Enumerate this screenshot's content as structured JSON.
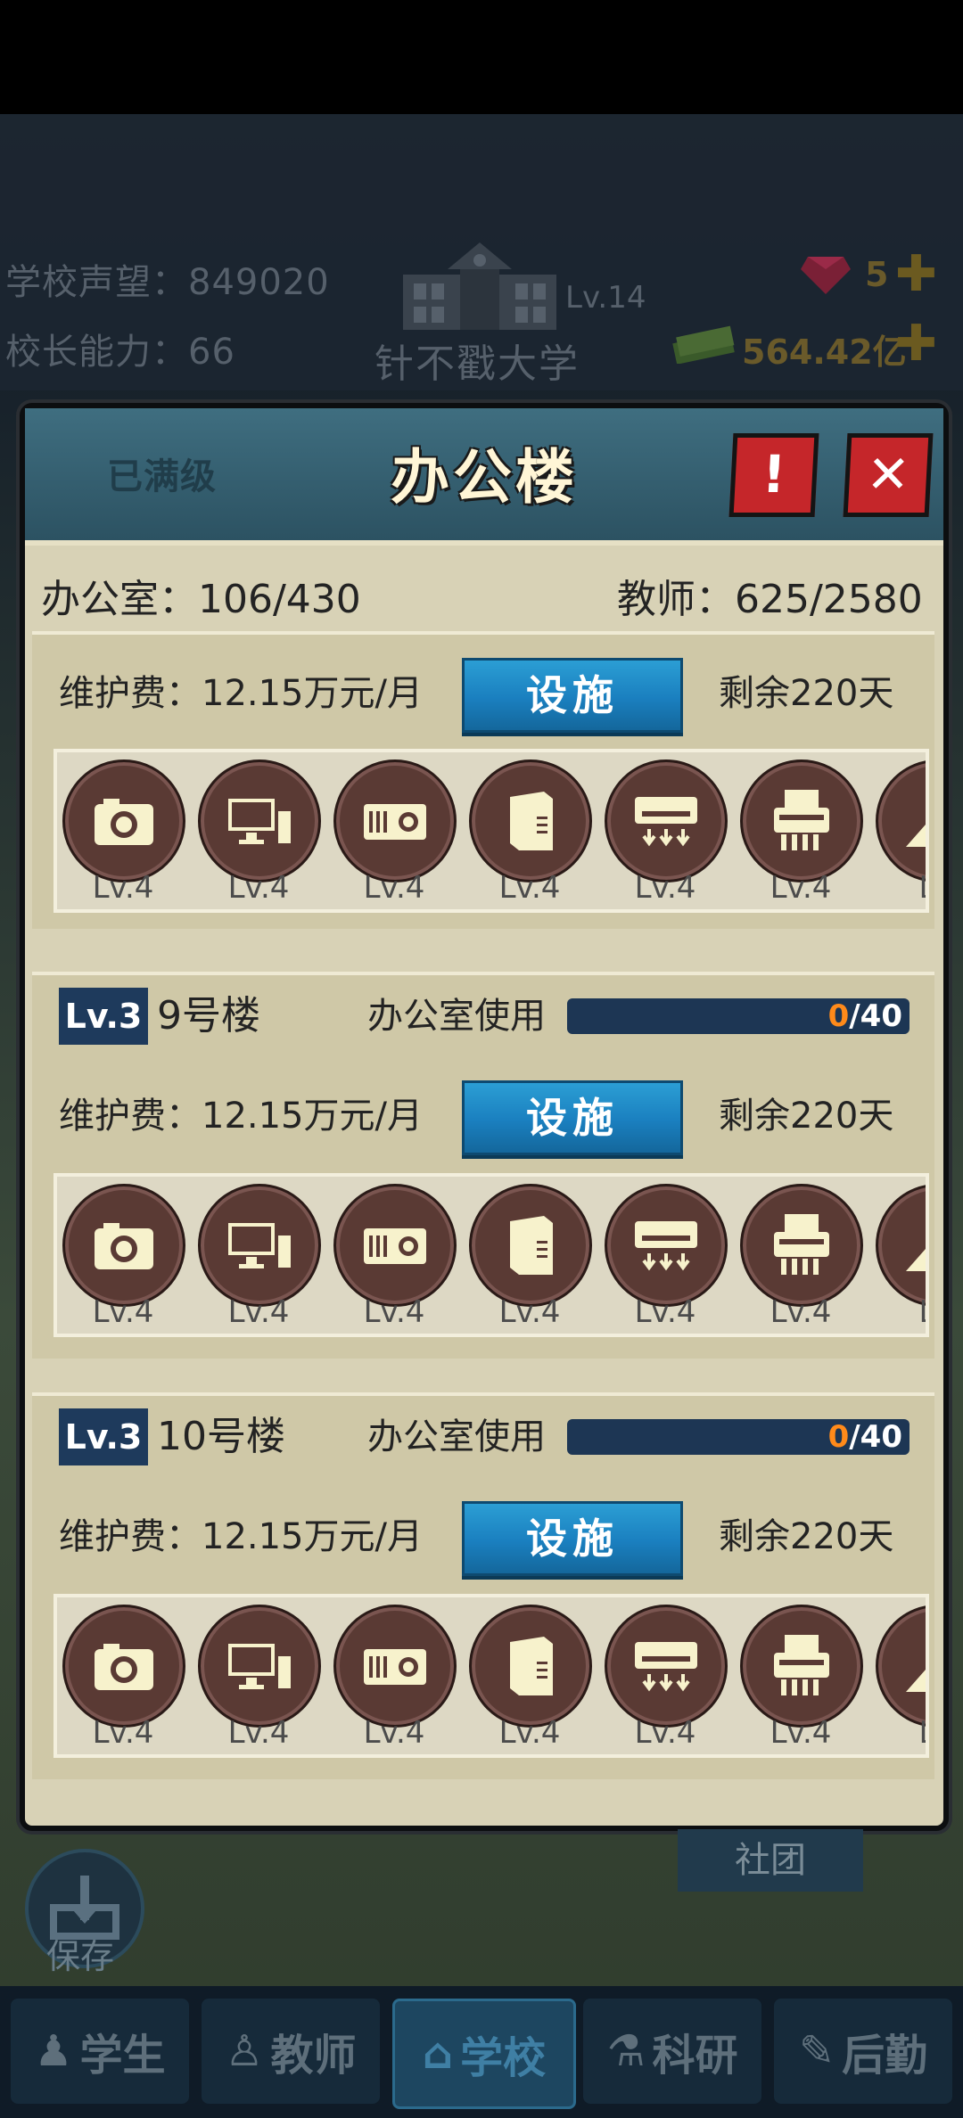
{
  "hud": {
    "reputation_label": "学校声望：",
    "reputation_value": "849020",
    "principal_label": "校长能力：",
    "principal_value": "66",
    "school_level": "Lv.14",
    "school_name": "针不戳大学",
    "gems": "5",
    "money": "564.42亿"
  },
  "modal": {
    "title": "办公楼",
    "maxed_label": "已满级",
    "offices_label": "办公室：",
    "offices_value": "106/430",
    "teachers_label": "教师：",
    "teachers_value": "625/2580"
  },
  "main_section": {
    "fee_text": "维护费：12.15万元/月",
    "facility_label": "设施",
    "remaining": "剩余220天",
    "facilities": [
      {
        "icon": "camera-icon",
        "level": "Lv.4"
      },
      {
        "icon": "computer-icon",
        "level": "Lv.4"
      },
      {
        "icon": "projector-icon",
        "level": "Lv.4"
      },
      {
        "icon": "water-dispenser-icon",
        "level": "Lv.4"
      },
      {
        "icon": "air-conditioner-icon",
        "level": "Lv.4"
      },
      {
        "icon": "shredder-icon",
        "level": "Lv.4"
      },
      {
        "icon": "partial-icon",
        "level": "Lv"
      }
    ]
  },
  "buildings": [
    {
      "level": "Lv.3",
      "name": "9号楼",
      "usage_label": "办公室使用",
      "usage_used": "0",
      "usage_total": "/40",
      "usage_fraction": 0,
      "fee_text": "维护费：12.15万元/月",
      "facility_label": "设施",
      "remaining": "剩余220天"
    },
    {
      "level": "Lv.3",
      "name": "10号楼",
      "usage_label": "办公室使用",
      "usage_used": "0",
      "usage_total": "/40",
      "usage_fraction": 0,
      "fee_text": "维护费：12.15万元/月",
      "facility_label": "设施",
      "remaining": "剩余220天"
    }
  ],
  "bottom": {
    "save_label": "保存",
    "club_label": "社团",
    "nav": [
      {
        "label": "学生",
        "icon": "student-icon"
      },
      {
        "label": "教师",
        "icon": "teacher-icon"
      },
      {
        "label": "学校",
        "icon": "school-icon",
        "active": true
      },
      {
        "label": "科研",
        "icon": "research-icon"
      },
      {
        "label": "后勤",
        "icon": "logistics-icon"
      }
    ]
  },
  "colors": {
    "accent_blue": "#1a7fbf",
    "header_teal": "#3f6e80",
    "alert_red": "#c5262a",
    "panel_beige": "#d8d2b6",
    "usage_orange": "#ff8a1a"
  }
}
